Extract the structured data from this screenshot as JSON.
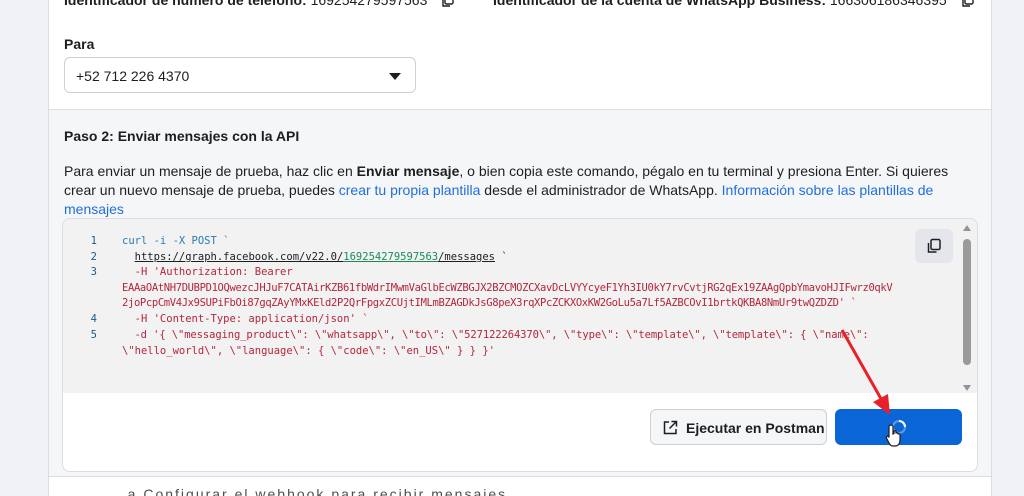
{
  "top": {
    "phone_id_label": "Identificador de número de teléfono:",
    "phone_id_value": "169254279597563",
    "account_id_label": "Identificador de la cuenta de WhatsApp Business:",
    "account_id_value": "166306186346395"
  },
  "to": {
    "label": "Para",
    "selected": "+52 712 226 4370"
  },
  "step2": {
    "title": "Paso 2: Enviar mensajes con la API",
    "desc_part1": "Para enviar un mensaje de prueba, haz clic en ",
    "desc_bold": "Enviar mensaje",
    "desc_part2": ", o bien copia este comando, pégalo en tu terminal y presiona Enter. Si quieres crear un nuevo mensaje de prueba, puedes ",
    "link_create": "crear tu propia plantilla",
    "desc_part3": " desde el administrador de WhatsApp. ",
    "link_info": "Información sobre las plantillas de mensajes"
  },
  "code": {
    "line_numbers": [
      "1",
      "2",
      "3",
      "4",
      "5"
    ],
    "l1": "curl -i -X POST `",
    "l2_url_a": "https://graph.facebook.com/v22.0/",
    "l2_id": "169254279597563",
    "l2_url_b": "/messages",
    "l2_tail": " `",
    "l3a": "  -H 'Authorization: Bearer",
    "l3b": "EAAaOAtNH7DUBPD1OQwezcJHJuF7CATAirKZB61fbWdrIMwmVaGlbEcWZBGJX2BZCMOZCXavDcLVYYcyeF1Yh3IU0kY7rvCvtjRG2qEx19ZAAgQpbYmavoHJIFwrz0qkV",
    "l3c": "2joPcpCmV4Jx9SUPiFbOi87gqZAyYMxKEld2P2QrFpgxZCUjtIMLmBZAGDkJsG8peX3rqXPcZCKXOxKW2GoLu5a7Lf5AZBCOvI1brtkQKBA8NmUr9twQZDZD' `",
    "l4": "  -H 'Content-Type: application/json' `",
    "l5a": "  -d '{ \\\"messaging_product\\\": \\\"whatsapp\\\", \\\"to\\\": \\\"527122264370\\\", \\\"type\\\": \\\"template\\\", \\\"template\\\": { \\\"name\\\":",
    "l5b": "\\\"hello_world\\\", \\\"language\\\": { \\\"code\\\": \\\"en_US\\\" } } }'"
  },
  "buttons": {
    "postman": "Ejecutar en Postman"
  },
  "footer": {
    "partial": "...a Configurar el webhook para recibir mensajes..."
  },
  "colors": {
    "primary": "#0a66d6",
    "link": "#216fdb",
    "arrow": "#e8202a"
  },
  "icons": {
    "copy": "copy-icon",
    "external": "external-link-icon",
    "spinner": "loading-spinner-icon",
    "cursor": "hand-cursor-icon"
  }
}
